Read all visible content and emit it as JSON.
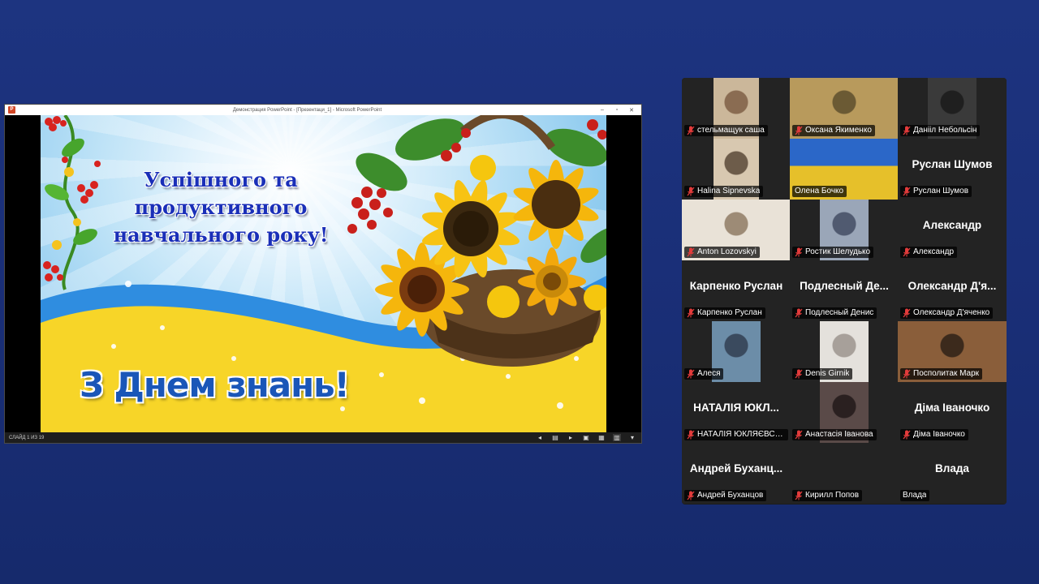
{
  "ppt": {
    "window_title": "Демонстрация PowerPoint - [Презентаци_1] - Microsoft PowerPoint",
    "app_icon": "P",
    "controls": [
      "–",
      "▫",
      "✕"
    ],
    "status_slide": "СЛАЙД 1 ИЗ 19",
    "status_icons": [
      "◂",
      "▤",
      "▸",
      "▣",
      "▦",
      "▥",
      "▾"
    ]
  },
  "slide": {
    "headline": [
      "Успішного та",
      "продуктивного",
      "навчального року!"
    ],
    "greeting": "З Днем знань!"
  },
  "participants": [
    {
      "name": "стельмащук саша",
      "video": true,
      "muted": true
    },
    {
      "name": "Оксана Якименко",
      "video": true,
      "muted": true
    },
    {
      "name": "Данііл Небольсін",
      "video": true,
      "muted": true
    },
    {
      "name": "Halina Sipnevska",
      "video": true,
      "muted": true
    },
    {
      "name": "Олена Бочко",
      "video": true,
      "muted": false,
      "speaking": true
    },
    {
      "name": "Руслан Шумов",
      "display": "Руслан Шумов",
      "video": false,
      "muted": true
    },
    {
      "name": "Anton Lozovskyi",
      "video": true,
      "muted": true
    },
    {
      "name": "Ростик Шелудько",
      "video": true,
      "muted": true
    },
    {
      "name": "Александр",
      "display": "Александр",
      "video": false,
      "muted": true
    },
    {
      "name": "Карпенко Руслан",
      "display": "Карпенко Руслан",
      "video": false,
      "muted": true
    },
    {
      "name": "Подлесный Денис",
      "display": "Подлесный Де...",
      "video": false,
      "muted": true
    },
    {
      "name": "Олександр Д'яченко",
      "display": "Олександр Д'я...",
      "video": false,
      "muted": true
    },
    {
      "name": "Алеся",
      "video": true,
      "muted": true
    },
    {
      "name": "Denis Girnik",
      "video": true,
      "muted": true
    },
    {
      "name": "Посполитак Марк",
      "video": true,
      "muted": true
    },
    {
      "name": "НАТАЛІЯ ЮКЛЯЄВСЬК...",
      "display": "НАТАЛІЯ ЮКЛ...",
      "video": false,
      "muted": true
    },
    {
      "name": "Анастасія Іванова",
      "video": true,
      "muted": true
    },
    {
      "name": "Діма Іваночко",
      "display": "Діма Іваночко",
      "video": false,
      "muted": true
    },
    {
      "name": "Андрей Буханцов",
      "display": "Андрей  Буханц...",
      "video": false,
      "muted": true
    },
    {
      "name": "Кирилл Попов",
      "video": true,
      "muted": true
    },
    {
      "name": "Влада",
      "display": "Влада",
      "video": false,
      "muted": false
    }
  ]
}
